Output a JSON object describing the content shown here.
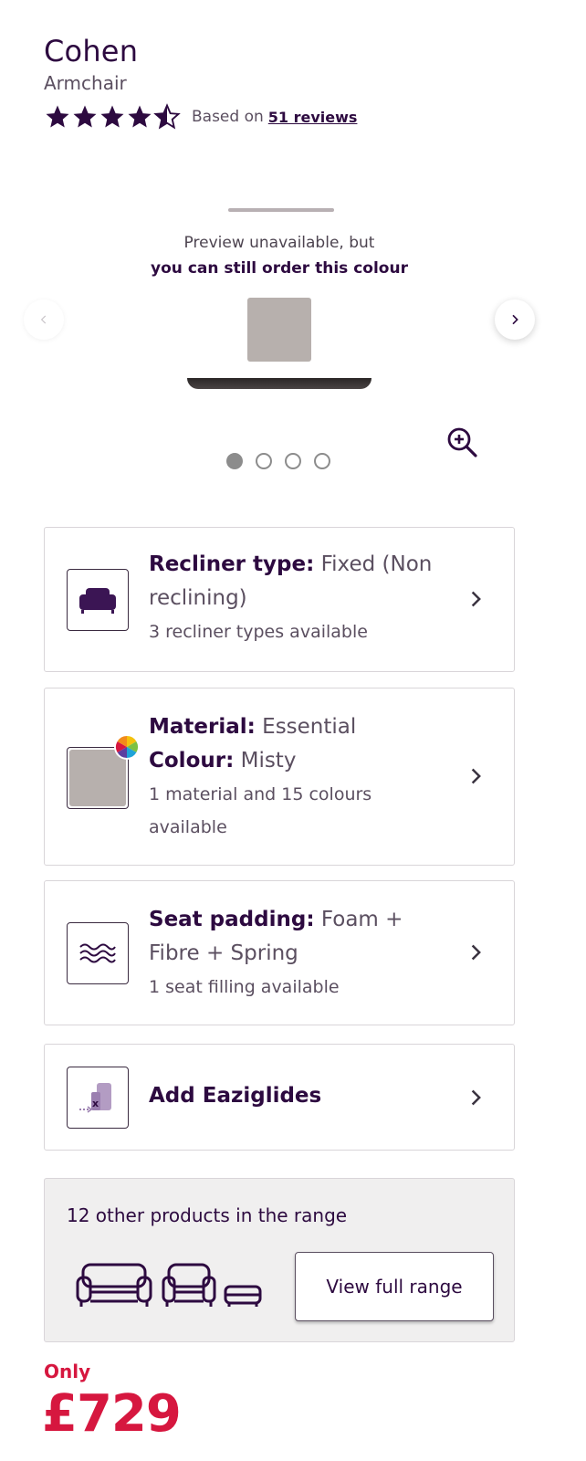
{
  "product": {
    "name": "Cohen",
    "type": "Armchair",
    "rating": 4.5,
    "rating_max": 5,
    "reviews_prefix": "Based on",
    "reviews_link": "51 reviews"
  },
  "gallery": {
    "preview_line1": "Preview unavailable, but",
    "preview_line2": "you can still order this colour",
    "swatch_color": "#b7b0ad",
    "slide_count": 4,
    "active_slide": 1
  },
  "options": [
    {
      "label": "Recliner type:",
      "value": "Fixed (Non reclining)",
      "sub": "3 recliner types available",
      "icon": "armchair-icon"
    },
    {
      "label_material": "Material:",
      "value_material": "Essential",
      "label_colour": "Colour:",
      "value_colour": "Misty",
      "sub": "1 material and 15 colours available",
      "icon": "colour-swatch-icon"
    },
    {
      "label": "Seat padding:",
      "value": "Foam + Fibre + Spring",
      "sub": "1 seat filling available",
      "icon": "seat-padding-icon"
    },
    {
      "label": "Add Eaziglides",
      "icon": "eaziglides-icon"
    }
  ],
  "range": {
    "text": "12 other products in the range",
    "button": "View full range"
  },
  "price": {
    "label": "Only",
    "amount": "£729"
  },
  "colors": {
    "brand": "#2d0a40",
    "price": "#d6173f",
    "swatch": "#b7b0ad"
  }
}
